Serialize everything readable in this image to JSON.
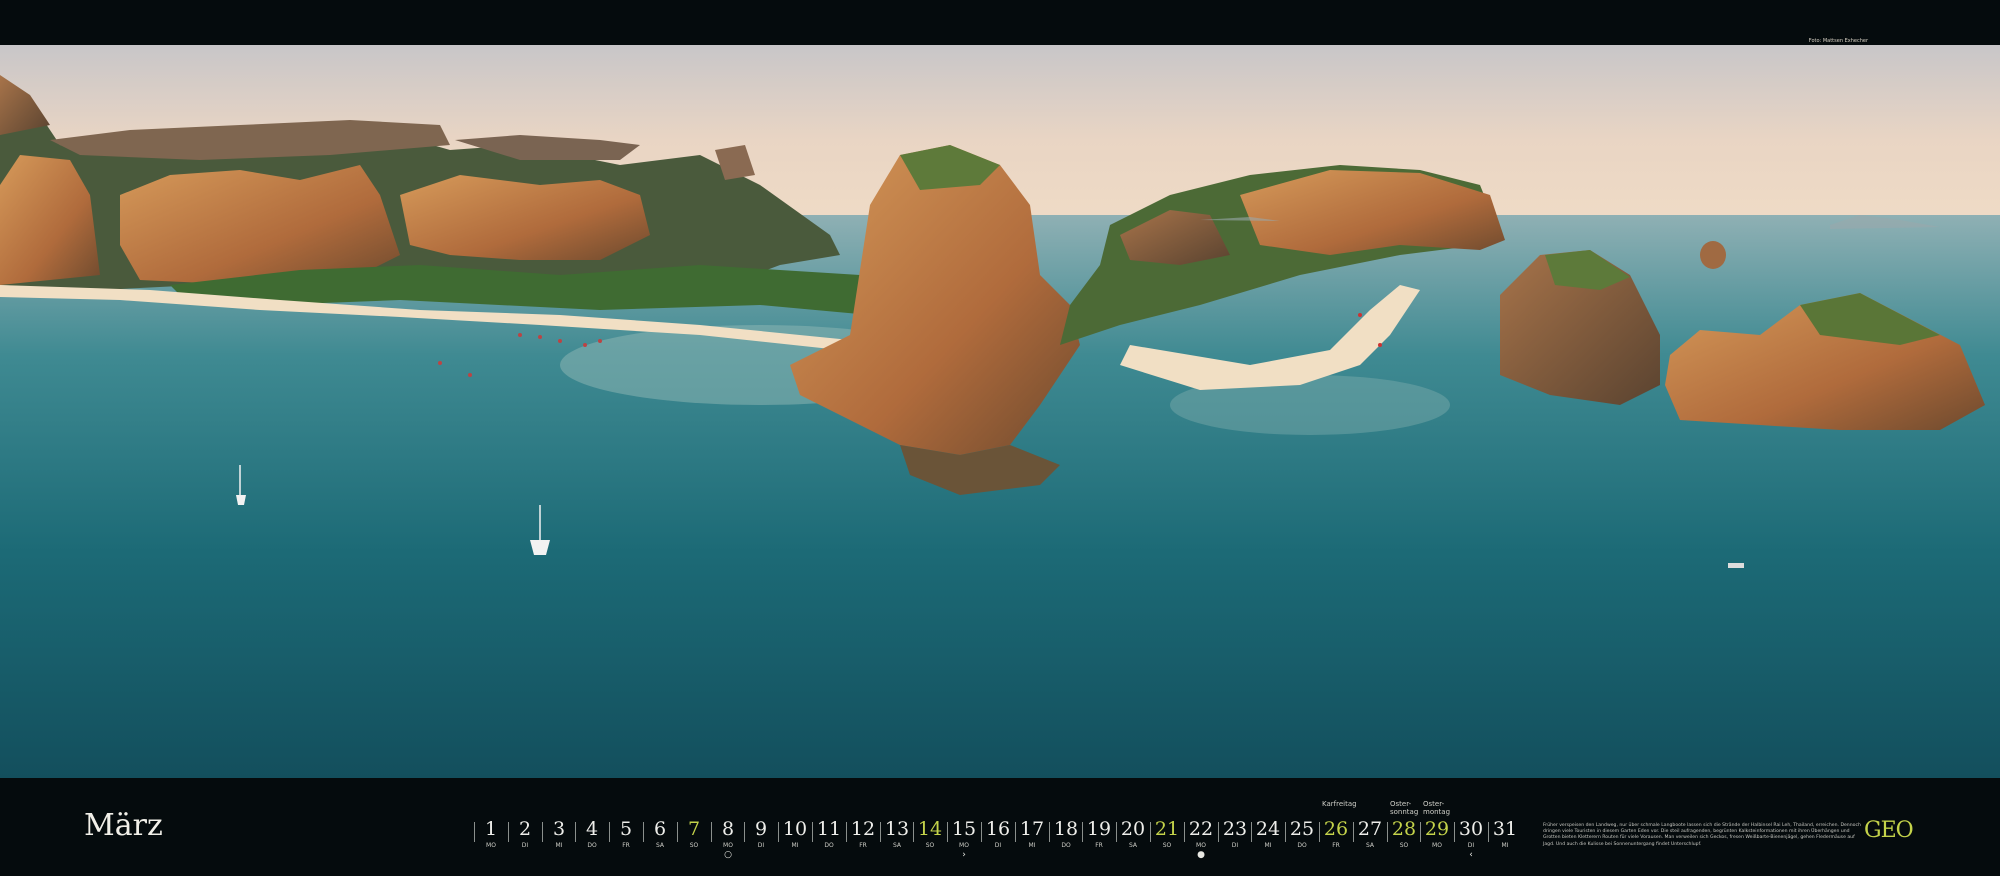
{
  "photo": {
    "credit": "Foto: Mattsen Exhecher",
    "icon": "landscape-photo"
  },
  "calendar": {
    "month": "März",
    "days": [
      {
        "num": "1",
        "dow": "MO",
        "weekend": false
      },
      {
        "num": "2",
        "dow": "DI",
        "weekend": false
      },
      {
        "num": "3",
        "dow": "MI",
        "weekend": false
      },
      {
        "num": "4",
        "dow": "DO",
        "weekend": false
      },
      {
        "num": "5",
        "dow": "FR",
        "weekend": false
      },
      {
        "num": "6",
        "dow": "SA",
        "weekend": false
      },
      {
        "num": "7",
        "dow": "SO",
        "weekend": true
      },
      {
        "num": "8",
        "dow": "MO",
        "weekend": false,
        "mark": "○"
      },
      {
        "num": "9",
        "dow": "DI",
        "weekend": false
      },
      {
        "num": "10",
        "dow": "MI",
        "weekend": false
      },
      {
        "num": "11",
        "dow": "DO",
        "weekend": false
      },
      {
        "num": "12",
        "dow": "FR",
        "weekend": false
      },
      {
        "num": "13",
        "dow": "SA",
        "weekend": false
      },
      {
        "num": "14",
        "dow": "SO",
        "weekend": true
      },
      {
        "num": "15",
        "dow": "MO",
        "weekend": false,
        "mark": "›"
      },
      {
        "num": "16",
        "dow": "DI",
        "weekend": false
      },
      {
        "num": "17",
        "dow": "MI",
        "weekend": false
      },
      {
        "num": "18",
        "dow": "DO",
        "weekend": false
      },
      {
        "num": "19",
        "dow": "FR",
        "weekend": false
      },
      {
        "num": "20",
        "dow": "SA",
        "weekend": false
      },
      {
        "num": "21",
        "dow": "SO",
        "weekend": true
      },
      {
        "num": "22",
        "dow": "MO",
        "weekend": false,
        "mark": "●"
      },
      {
        "num": "23",
        "dow": "DI",
        "weekend": false
      },
      {
        "num": "24",
        "dow": "MI",
        "weekend": false
      },
      {
        "num": "25",
        "dow": "DO",
        "weekend": false
      },
      {
        "num": "26",
        "dow": "FR",
        "weekend": true,
        "holiday": "Karfreitag"
      },
      {
        "num": "27",
        "dow": "SA",
        "weekend": false
      },
      {
        "num": "28",
        "dow": "SO",
        "weekend": true,
        "holiday": "Oster-\nsonntag"
      },
      {
        "num": "29",
        "dow": "MO",
        "weekend": true,
        "holiday": "Oster-\nmontag"
      },
      {
        "num": "30",
        "dow": "DI",
        "weekend": false,
        "mark": "‹"
      },
      {
        "num": "31",
        "dow": "MI",
        "weekend": false
      }
    ]
  },
  "caption": "Früher verspeisen den Landweg, nur über schmale Langboote lassen sich die Strände der Halbinsel Rai Leh, Thailand, erreichen. Dennoch dringen viele Touristen in diesem Garten Eden vor. Die steil aufragenden, begrünten Kalksteinformationen mit ihren Überhängen und Grotten bieten Kletterern Routen für viele Vorausen. Man verweilen sich Geckos, fresen Weißbarte-Bienenjägel, gehen Fledermäuse auf Jagd. Und auch die Kulisse bei Sonnenuntergang findet Unterschlupf.",
  "brand": {
    "logo": "GEO",
    "accent": "#c4d34a"
  },
  "colors": {
    "background": "#050b0d",
    "sea": "#1f6f7a",
    "sky": "#e8d8c4"
  }
}
